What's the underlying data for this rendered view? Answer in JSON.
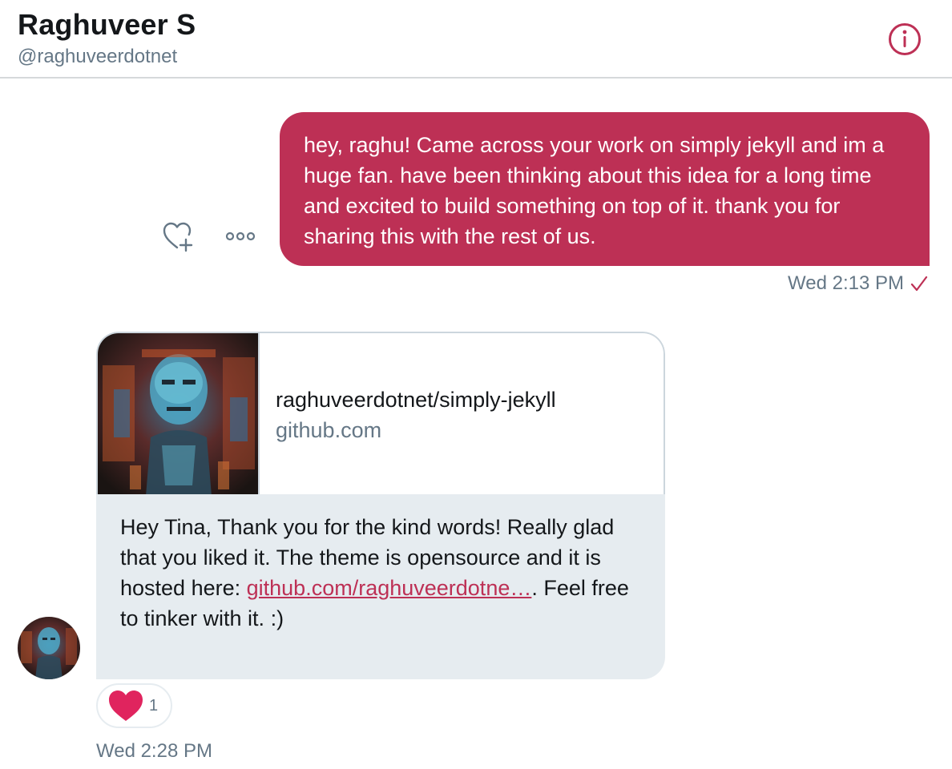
{
  "header": {
    "title": "Raghuveer S",
    "handle": "@raghuveerdotnet",
    "info_icon": "info-icon"
  },
  "outgoing": {
    "text": "hey, raghu! Came across your work on simply jekyll and im a huge fan. have been thinking about this idea for a long time and excited to build something on top of it. thank you for sharing this with the rest of us.",
    "timestamp": "Wed 2:13 PM",
    "status_icon": "checkmark-icon",
    "actions": {
      "react_icon": "heart-plus-icon",
      "more_icon": "more-options-icon"
    }
  },
  "incoming": {
    "card": {
      "title": "raghuveerdotnet/simply-jekyll",
      "domain": "github.com"
    },
    "text_before": "Hey Tina, Thank you for the kind words! Really glad that you liked it. The theme is opensource and it is hosted here: ",
    "link_text": "github.com/raghuveerdotne…",
    "text_after": ". Feel free to tinker with it. :)",
    "reaction": {
      "icon": "heart-icon",
      "count": "1"
    },
    "timestamp": "Wed 2:28 PM"
  },
  "colors": {
    "accent": "#bd3055",
    "incoming_bg": "#e6ecf0",
    "muted_text": "#657786",
    "border": "#ccd6dd"
  }
}
